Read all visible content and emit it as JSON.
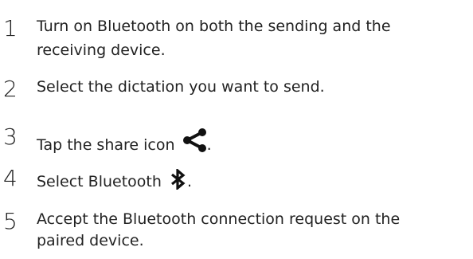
{
  "steps": [
    {
      "number": "1",
      "line1": "Turn on Bluetooth on both the sending and the",
      "line2": "receiving device."
    },
    {
      "number": "2",
      "line1": "Select the dictation you want to send."
    },
    {
      "number": "3",
      "prefix": "Tap the share icon ",
      "icon": "share-icon",
      "suffix": "."
    },
    {
      "number": "4",
      "prefix": "Select Bluetooth ",
      "icon": "bluetooth-icon",
      "suffix": "."
    },
    {
      "number": "5",
      "line1": "Accept the Bluetooth connection request on the",
      "line2": "paired device."
    }
  ]
}
